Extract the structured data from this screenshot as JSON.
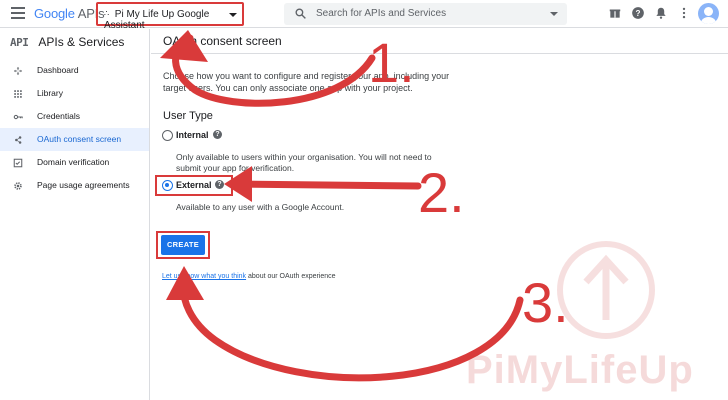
{
  "topbar": {
    "logo_google": "Google",
    "logo_apis": "APIs",
    "project_name": "Pi My Life Up Google Assistant",
    "search_placeholder": "Search for APIs and Services"
  },
  "sidebar": {
    "badge": "API",
    "title": "APIs & Services",
    "items": [
      {
        "label": "Dashboard",
        "icon": "dashboard-icon"
      },
      {
        "label": "Library",
        "icon": "library-icon"
      },
      {
        "label": "Credentials",
        "icon": "key-icon"
      },
      {
        "label": "OAuth consent screen",
        "icon": "oauth-icon"
      },
      {
        "label": "Domain verification",
        "icon": "domain-icon"
      },
      {
        "label": "Page usage agreements",
        "icon": "settings-icon"
      }
    ]
  },
  "main": {
    "title": "OAuth consent screen",
    "intro": "Choose how you want to configure and register your app, including your target users. You can only associate one app with your project.",
    "user_type_heading": "User Type",
    "options": [
      {
        "label": "Internal",
        "description": "Only available to users within your organisation. You will not need to submit your app for verification.",
        "selected": false
      },
      {
        "label": "External",
        "description": "Available to any user with a Google Account.",
        "selected": true
      }
    ],
    "create_button": "CREATE",
    "feedback_link": "Let us know what you think",
    "feedback_suffix": "about our OAuth experience"
  },
  "annotations": {
    "step1": "1.",
    "step2": "2.",
    "step3": "3.",
    "watermark": "PiMyLifeUp",
    "accent_color": "#d93a3a"
  }
}
